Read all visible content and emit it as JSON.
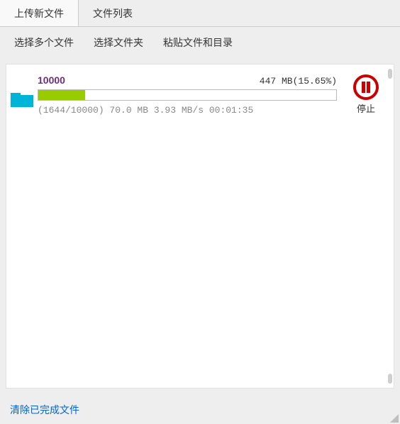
{
  "tabs": {
    "upload_new": "上传新文件",
    "file_list": "文件列表"
  },
  "toolbar": {
    "select_multiple": "选择多个文件",
    "select_folder": "选择文件夹",
    "paste_files": "粘贴文件和目录"
  },
  "upload": {
    "name": "10000",
    "size_label": "447 MB(15.65%)",
    "progress_percent": 15.65,
    "stats_line": "(1644/10000) 70.0 MB 3.93 MB/s 00:01:35",
    "stop_label": "停止"
  },
  "footer": {
    "clear_completed": "清除已完成文件"
  },
  "colors": {
    "progress": "#99cc00",
    "accent_purple": "#702c7c",
    "danger": "#cc0000",
    "link": "#0066cc"
  }
}
